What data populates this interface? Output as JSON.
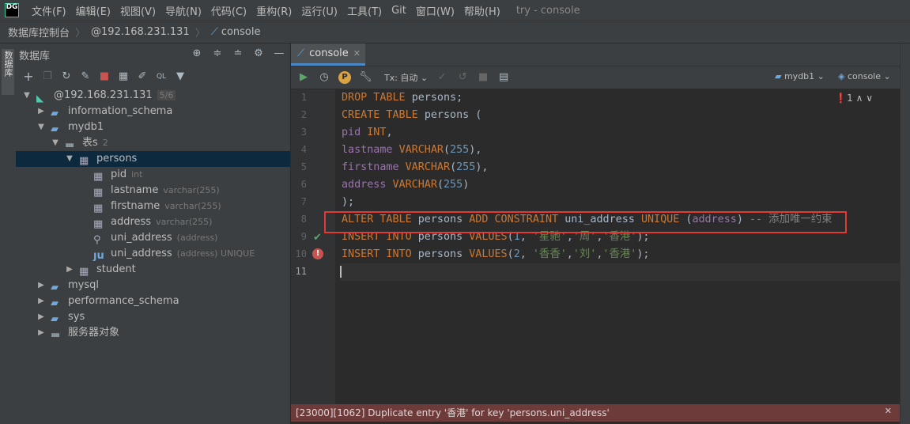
{
  "menubar": {
    "logo": "DG",
    "items": [
      "文件(F)",
      "编辑(E)",
      "视图(V)",
      "导航(N)",
      "代码(C)",
      "重构(R)",
      "运行(U)",
      "工具(T)",
      "Git",
      "窗口(W)",
      "帮助(H)"
    ],
    "app_title": "try - console"
  },
  "breadcrumb": [
    "数据库控制台",
    "@192.168.231.131",
    "console"
  ],
  "side_strip_label": "数据库",
  "db_panel": {
    "title": "数据库",
    "tree": [
      {
        "label": "@192.168.231.131",
        "sub": "5/6"
      },
      {
        "label": "information_schema",
        "sub": ""
      },
      {
        "label": "mydb1",
        "sub": ""
      },
      {
        "label": "表s",
        "sub": "2"
      },
      {
        "label": "persons",
        "sub": ""
      },
      {
        "label": "pid",
        "sub": "int"
      },
      {
        "label": "lastname",
        "sub": "varchar(255)"
      },
      {
        "label": "firstname",
        "sub": "varchar(255)"
      },
      {
        "label": "address",
        "sub": "varchar(255)"
      },
      {
        "label": "uni_address",
        "sub": "(address)"
      },
      {
        "label": "uni_address",
        "sub": "(address) UNIQUE"
      },
      {
        "label": "student",
        "sub": ""
      },
      {
        "label": "mysql",
        "sub": ""
      },
      {
        "label": "performance_schema",
        "sub": ""
      },
      {
        "label": "sys",
        "sub": ""
      },
      {
        "label": "服务器对象",
        "sub": ""
      }
    ]
  },
  "editor": {
    "tab_label": "console",
    "tx_label": "Tx: 自动",
    "schema_selector": "mydb1",
    "session_selector": "console",
    "error_count": "1",
    "line_numbers": [
      "1",
      "2",
      "3",
      "4",
      "5",
      "6",
      "7",
      "8",
      "9",
      "10",
      "11"
    ],
    "code_lines": [
      "DROP TABLE persons;",
      "CREATE TABLE persons (",
      "pid INT,",
      "lastname VARCHAR(255),",
      "firstname VARCHAR(255),",
      "address VARCHAR(255)",
      ");",
      "ALTER TABLE persons ADD CONSTRAINT uni_address UNIQUE (address) -- 添加唯一约束",
      "INSERT INTO persons VALUES(1, '星驰','周','香港');",
      "INSERT INTO persons VALUES(2, '香香','刘','香港');",
      ""
    ],
    "error_message": "[23000][1062] Duplicate entry '香港' for key 'persons.uni_address'"
  },
  "colors": {
    "highlight_box": "#e53935",
    "error_bar": "#6e3b3b",
    "keyword": "#cc7832",
    "number": "#6897bb",
    "string": "#6a8759"
  }
}
